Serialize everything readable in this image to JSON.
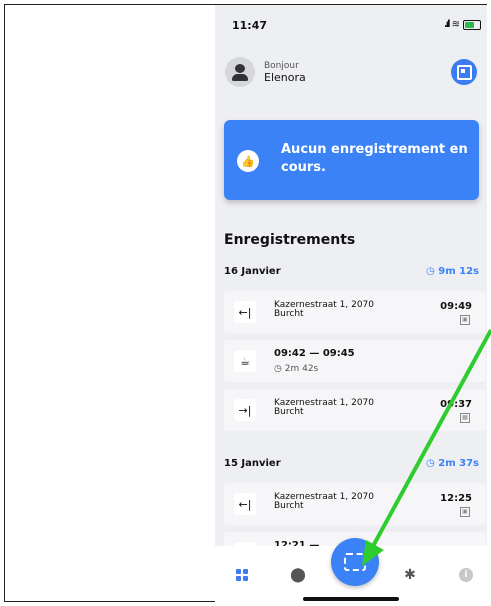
{
  "status_bar": {
    "time": "11:47"
  },
  "header": {
    "greeting": "Bonjour",
    "user_name": "Elenora"
  },
  "banner": {
    "text": "Aucun enregistrement en cours."
  },
  "section_title": "Enregistrements",
  "days": [
    {
      "label": "16 Janvier",
      "total": "9m 12s",
      "entries": [
        {
          "kind": "entry",
          "icon": "←|",
          "address_line1": "Kazernestraat 1, 2070",
          "address_line2": "Burcht",
          "time": "09:49"
        },
        {
          "kind": "break",
          "icon": "☕",
          "start": "09:42",
          "end": "09:45",
          "duration": "2m 42s"
        },
        {
          "kind": "exit",
          "icon": "→|",
          "address_line1": "Kazernestraat 1, 2070",
          "address_line2": "Burcht",
          "time": "09:37"
        }
      ]
    },
    {
      "label": "15 Janvier",
      "total": "2m 37s",
      "entries": [
        {
          "kind": "entry",
          "icon": "←|",
          "address_line1": "Kazernestraat 1, 2070",
          "address_line2": "Burcht",
          "time": "12:25"
        },
        {
          "kind": "break",
          "icon": "☕",
          "start": "12:21",
          "end": ""
        }
      ]
    }
  ],
  "tabbar": {
    "icons": [
      "grid-icon",
      "location-pin-icon",
      "barcode-scan-icon",
      "gear-icon",
      "info-icon"
    ]
  },
  "colors": {
    "accent": "#3b82f6",
    "background": "#eeeff2",
    "annotation_arrow": "#2ecc2e"
  }
}
